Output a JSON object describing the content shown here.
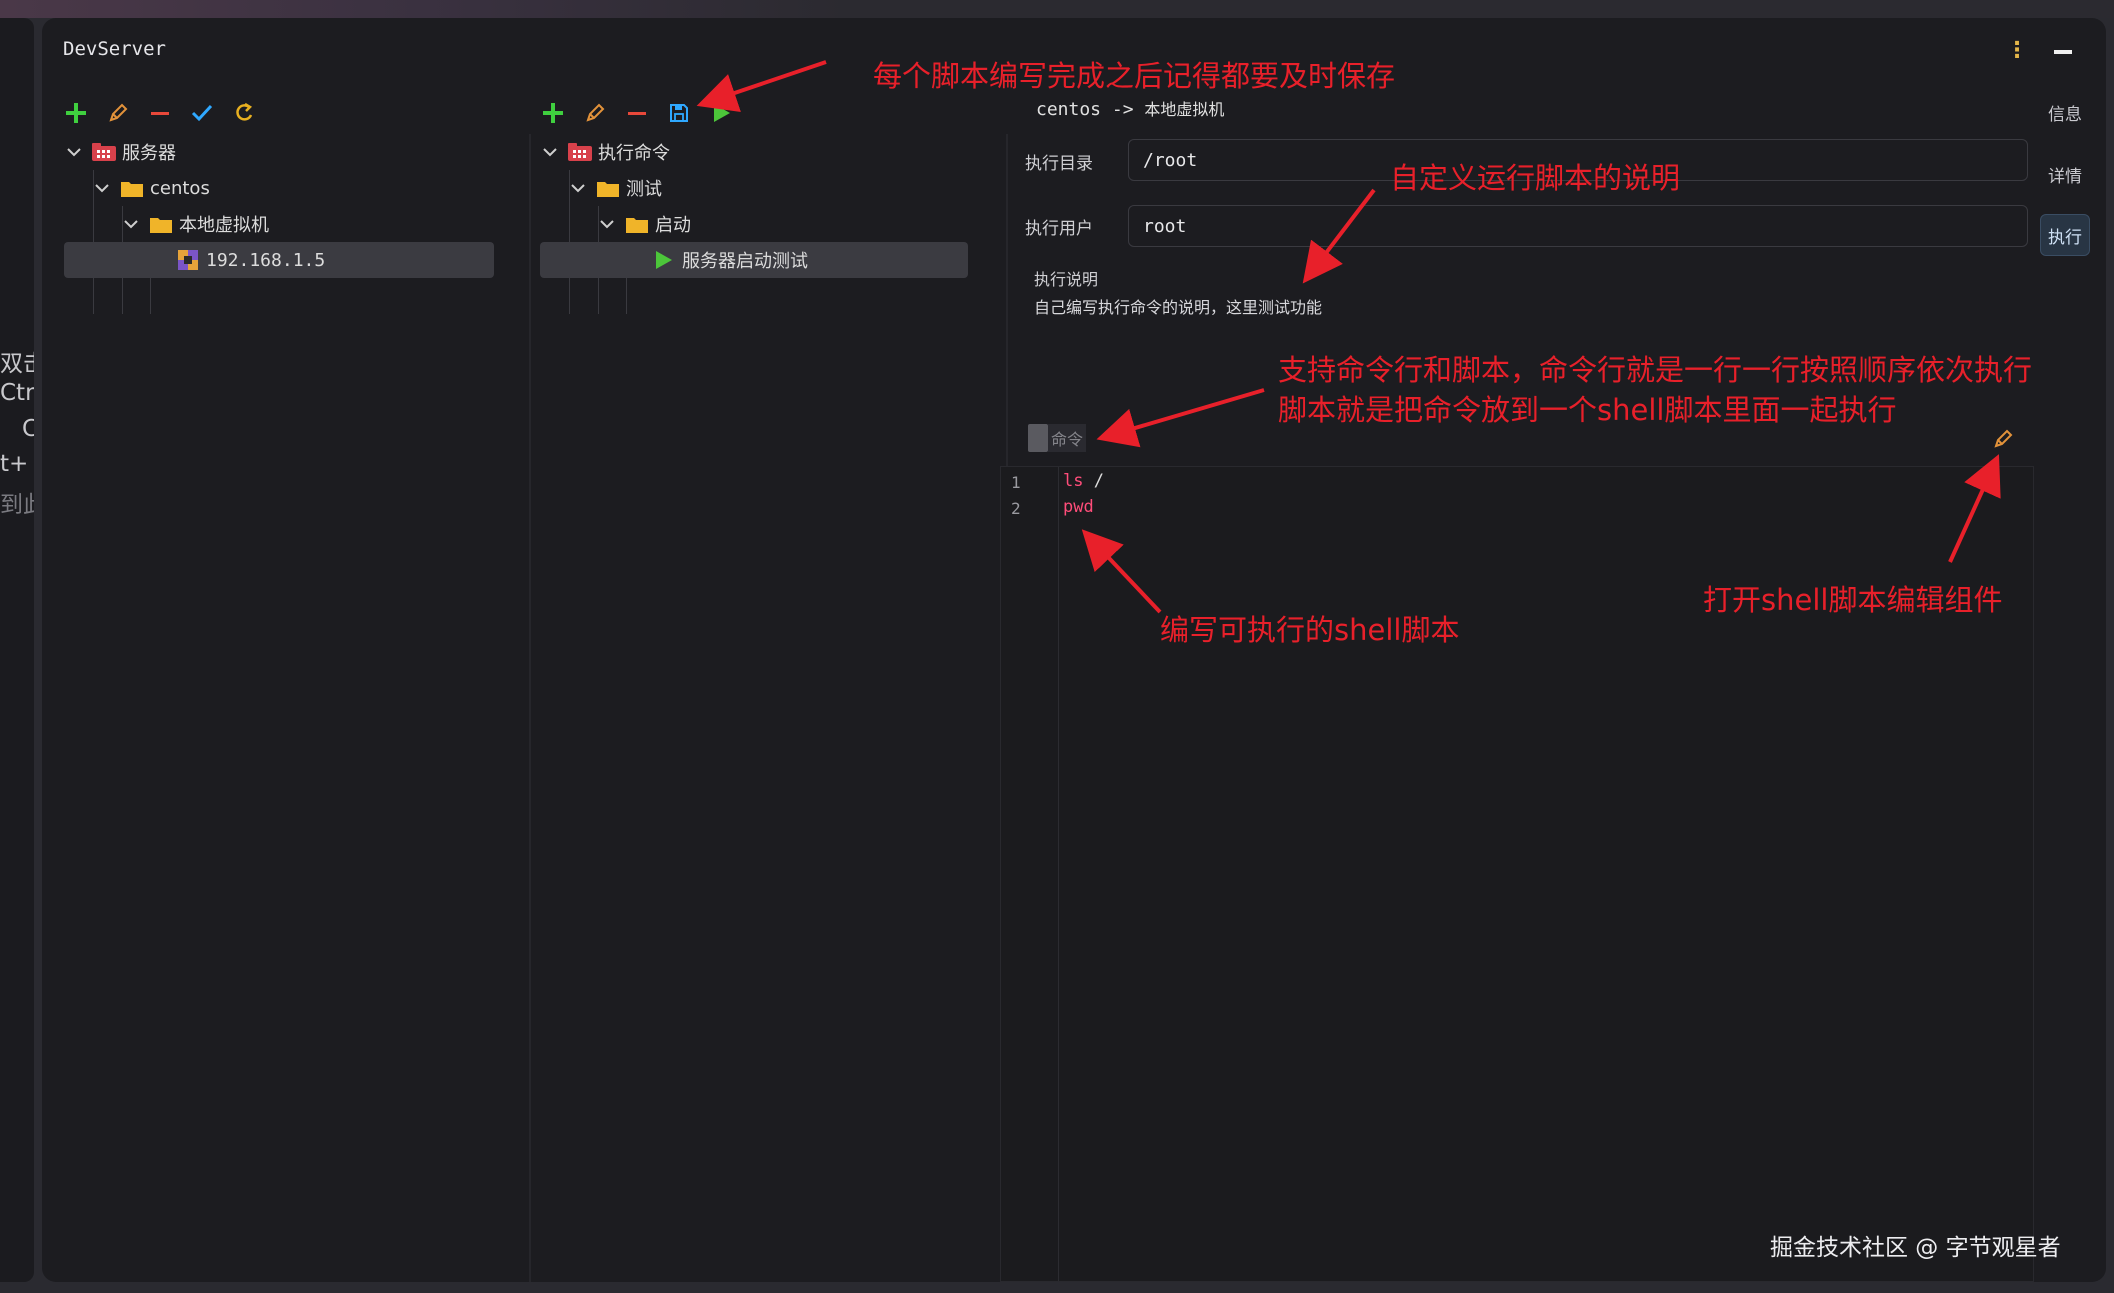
{
  "window": {
    "title": "DevServer"
  },
  "left_edge_text": [
    "双击",
    "Ctrl",
    "C",
    "t+",
    "到此"
  ],
  "server_tree": {
    "root": "服务器",
    "group": "centos",
    "subgroup": "本地虚拟机",
    "host": "192.168.1.5"
  },
  "command_tree": {
    "root": "执行命令",
    "group": "测试",
    "subgroup": "启动",
    "script": "服务器启动测试"
  },
  "breadcrumb": {
    "server": "centos",
    "sep": "->",
    "target": "本地虚拟机"
  },
  "side_tabs": {
    "info": "信息",
    "detail": "详情",
    "execute": "执行"
  },
  "form": {
    "dir_label": "执行目录",
    "dir_value": "/root",
    "user_label": "执行用户",
    "user_value": "root",
    "desc_title": "执行说明",
    "desc_text": "自己编写执行命令的说明，这里测试功能"
  },
  "mode_toggle": {
    "label": "命令"
  },
  "editor": {
    "lines": [
      {
        "num": "1",
        "cmd": "ls",
        "arg": " /"
      },
      {
        "num": "2",
        "cmd": "pwd",
        "arg": ""
      }
    ]
  },
  "annotations": {
    "save": "每个脚本编写完成之后记得都要及时保存",
    "desc": "自定义运行脚本的说明",
    "mode_line1": "支持命令行和脚本，命令行就是一行一行按照顺序依次执行",
    "mode_line2": "脚本就是把命令放到一个shell脚本里面一起执行",
    "editor": "编写可执行的shell脚本",
    "open_editor": "打开shell脚本编辑组件"
  },
  "watermark": "掘金技术社区 @ 字节观星者",
  "colors": {
    "annotation": "#e8202a",
    "add": "#3fcf3f",
    "remove": "#e8483a",
    "edit": "#e2923a",
    "check": "#2fa8ff",
    "refresh": "#e8b020",
    "run": "#4cc63a",
    "folder": "#f0b429"
  }
}
